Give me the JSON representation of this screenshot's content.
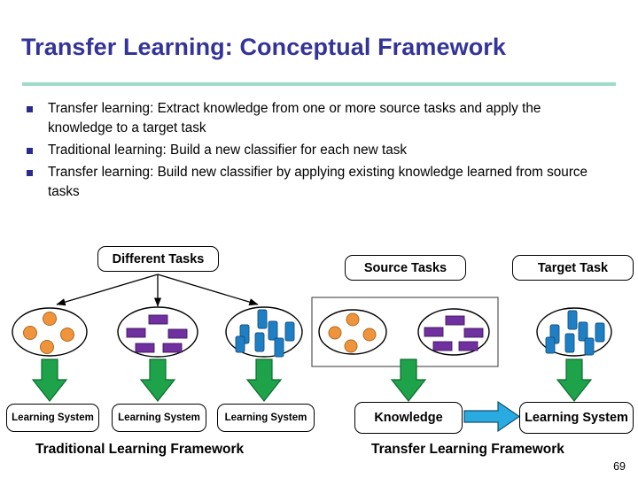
{
  "slide": {
    "title": "Transfer Learning: Conceptual Framework",
    "page_number": "69",
    "title_color": "#333399",
    "rule_color": "#9edbc9"
  },
  "bullets": [
    {
      "text": "Transfer learning: Extract knowledge from one or more source tasks and apply the knowledge to a target task"
    },
    {
      "text": "Traditional learning: Build a new classifier for each new task"
    },
    {
      "text": "Transfer learning: Build new classifier by applying existing knowledge learned from source tasks"
    }
  ],
  "diagram": {
    "colors": {
      "orange_item": "#f0943c",
      "purple_item": "#7030a0",
      "blue_item": "#1f7fc4",
      "green_arrow": "#1ea34a",
      "cyan_arrow": "#29abe2",
      "outline": "#000000"
    },
    "left_panel": {
      "caption": "Traditional Learning Framework",
      "top_box": "Different Tasks",
      "task_groups": [
        {
          "shape": "circle",
          "color_name": "orange_item",
          "count": 4
        },
        {
          "shape": "rect-h",
          "color_name": "purple_item",
          "count": 5
        },
        {
          "shape": "rect-v",
          "color_name": "blue_item",
          "count": 7
        }
      ],
      "learning_systems": [
        "Learning System",
        "Learning System",
        "Learning System"
      ]
    },
    "right_panel": {
      "caption": "Transfer Learning Framework",
      "source_label": "Source Tasks",
      "target_label": "Target Task",
      "source_groups": [
        {
          "shape": "circle",
          "color_name": "orange_item",
          "count": 4
        },
        {
          "shape": "rect-h",
          "color_name": "purple_item",
          "count": 5
        }
      ],
      "target_group": {
        "shape": "rect-v",
        "color_name": "blue_item",
        "count": 7
      },
      "knowledge_box": "Knowledge",
      "learning_system_box": "Learning System"
    }
  }
}
